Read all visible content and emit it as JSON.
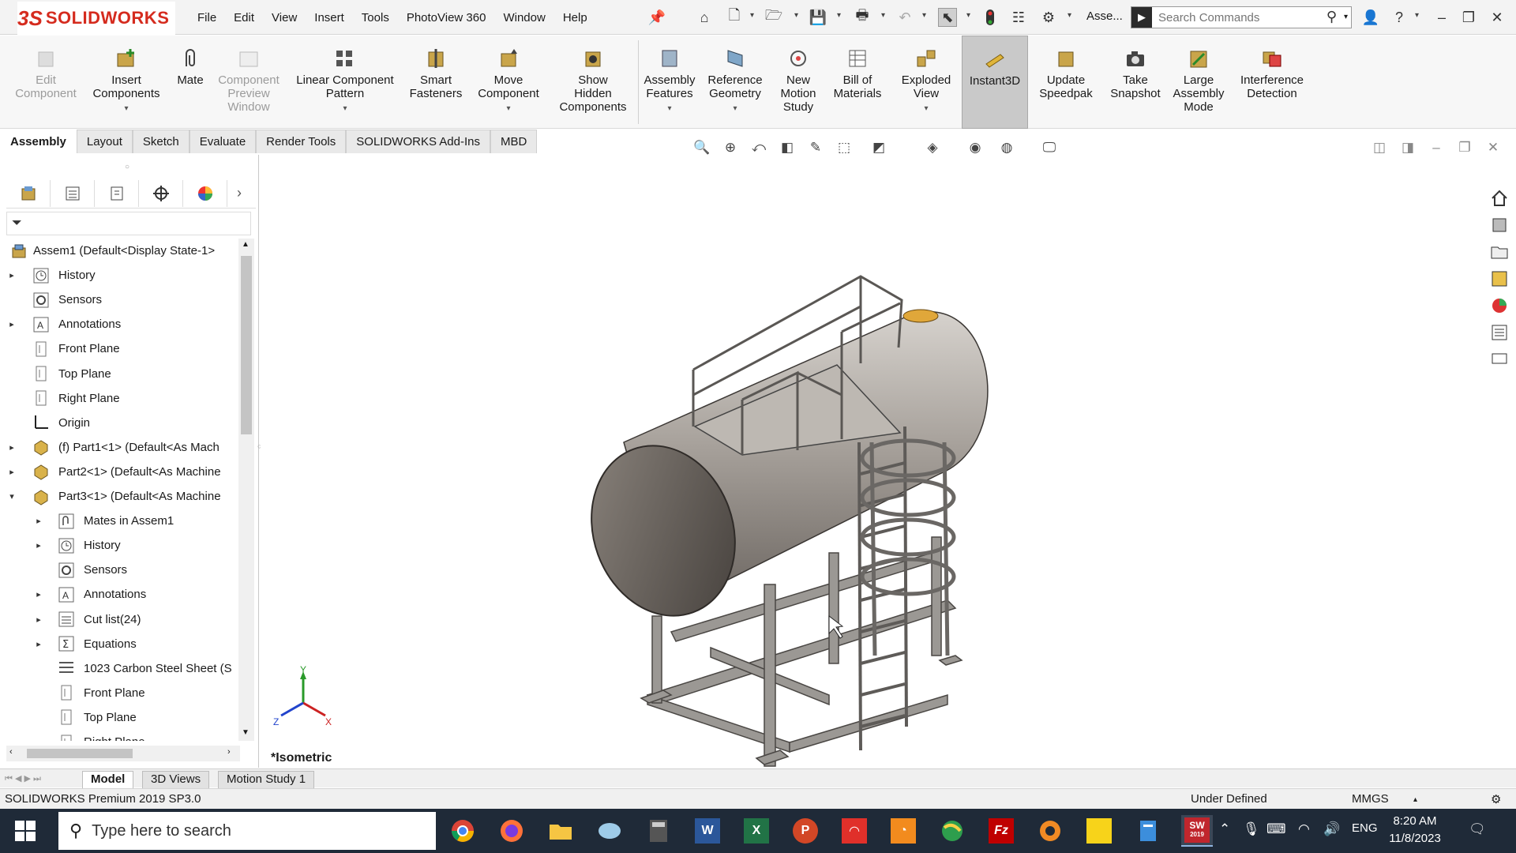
{
  "app": {
    "logo_ds": "3S",
    "logo_name": "SOLIDWORKS"
  },
  "menu": [
    "File",
    "Edit",
    "View",
    "Insert",
    "Tools",
    "PhotoView 360",
    "Window",
    "Help"
  ],
  "title_doc": "Asse...",
  "search": {
    "placeholder": "Search Commands"
  },
  "commands": [
    {
      "label": "Edit\nComponent",
      "disabled": true
    },
    {
      "label": "Insert\nComponents",
      "dropdown": true
    },
    {
      "label": "Mate"
    },
    {
      "label": "Component\nPreview\nWindow",
      "disabled": true
    },
    {
      "label": "Linear Component\nPattern",
      "dropdown": true
    },
    {
      "label": "Smart\nFasteners"
    },
    {
      "label": "Move\nComponent",
      "dropdown": true
    },
    {
      "label": "Show\nHidden\nComponents"
    },
    {
      "label": "Assembly\nFeatures",
      "dropdown": true
    },
    {
      "label": "Reference\nGeometry",
      "dropdown": true
    },
    {
      "label": "New\nMotion\nStudy"
    },
    {
      "label": "Bill of\nMaterials"
    },
    {
      "label": "Exploded\nView",
      "dropdown": true
    },
    {
      "label": "Instant3D",
      "active": true
    },
    {
      "label": "Update\nSpeedpak"
    },
    {
      "label": "Take\nSnapshot"
    },
    {
      "label": "Large\nAssembly\nMode"
    },
    {
      "label": "Interference\nDetection"
    }
  ],
  "tabs": [
    "Assembly",
    "Layout",
    "Sketch",
    "Evaluate",
    "Render Tools",
    "SOLIDWORKS Add-Ins",
    "MBD"
  ],
  "tree": [
    {
      "label": "Assem1  (Default<Display State-1>",
      "icon": "assembly-icon",
      "level": 0,
      "exp": ""
    },
    {
      "label": "History",
      "icon": "history-icon",
      "level": 1,
      "exp": "▸"
    },
    {
      "label": "Sensors",
      "icon": "sensors-icon",
      "level": 1,
      "exp": ""
    },
    {
      "label": "Annotations",
      "icon": "annotations-icon",
      "level": 1,
      "exp": "▸"
    },
    {
      "label": "Front Plane",
      "icon": "plane-icon",
      "level": 1,
      "exp": ""
    },
    {
      "label": "Top Plane",
      "icon": "plane-icon",
      "level": 1,
      "exp": ""
    },
    {
      "label": "Right Plane",
      "icon": "plane-icon",
      "level": 1,
      "exp": ""
    },
    {
      "label": "Origin",
      "icon": "origin-icon",
      "level": 1,
      "exp": ""
    },
    {
      "label": "(f) Part1<1> (Default<As Mach",
      "icon": "part-icon",
      "level": 1,
      "exp": "▸"
    },
    {
      "label": "Part2<1> (Default<As Machine",
      "icon": "part-icon",
      "level": 1,
      "exp": "▸"
    },
    {
      "label": "Part3<1> (Default<As Machine",
      "icon": "part-icon",
      "level": 1,
      "exp": "▾"
    },
    {
      "label": "Mates in Assem1",
      "icon": "mates-icon",
      "level": 2,
      "exp": "▸"
    },
    {
      "label": "History",
      "icon": "history-icon",
      "level": 2,
      "exp": "▸"
    },
    {
      "label": "Sensors",
      "icon": "sensors-icon",
      "level": 2,
      "exp": ""
    },
    {
      "label": "Annotations",
      "icon": "annotations-icon",
      "level": 2,
      "exp": "▸"
    },
    {
      "label": "Cut list(24)",
      "icon": "cutlist-icon",
      "level": 2,
      "exp": "▸"
    },
    {
      "label": "Equations",
      "icon": "equations-icon",
      "level": 2,
      "exp": "▸"
    },
    {
      "label": "1023 Carbon Steel Sheet (S",
      "icon": "material-icon",
      "level": 2,
      "exp": ""
    },
    {
      "label": "Front Plane",
      "icon": "plane-icon",
      "level": 2,
      "exp": ""
    },
    {
      "label": "Top Plane",
      "icon": "plane-icon",
      "level": 2,
      "exp": ""
    },
    {
      "label": "Right Plane",
      "icon": "plane-icon",
      "level": 2,
      "exp": ""
    }
  ],
  "viewport": {
    "view_label": "*Isometric",
    "axis_x": "X",
    "axis_y": "Y",
    "axis_z": "Z"
  },
  "bottom_tabs": [
    "Model",
    "3D Views",
    "Motion Study 1"
  ],
  "status": {
    "product": "SOLIDWORKS Premium 2019 SP3.0",
    "state": "Under Defined",
    "units": "MMGS"
  },
  "taskbar": {
    "search_placeholder": "Type here to search",
    "lang": "ENG",
    "time": "8:20 AM",
    "date": "11/8/2023",
    "sw_badge": "SW",
    "sw_year": "2019"
  },
  "colors": {
    "accent": "#d52b1e",
    "taskbar": "#1f2a38",
    "steel": "#8d8a87"
  }
}
